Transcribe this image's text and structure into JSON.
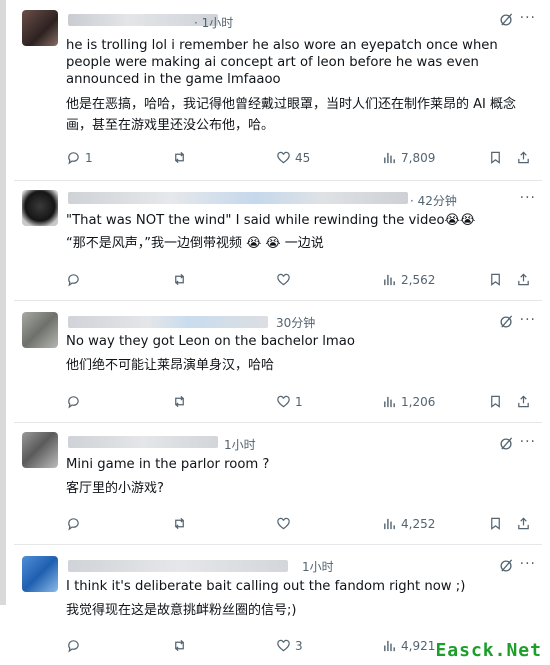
{
  "watermark": "Easck.Net",
  "colors": {
    "text": "#0f1419",
    "muted": "#536471",
    "watermark": "#1b9f2a"
  },
  "actions": {
    "reply_icon": "reply-icon",
    "repost_icon": "repost-icon",
    "like_icon": "heart-icon",
    "views_icon": "views-icon",
    "bookmark_icon": "bookmark-icon",
    "share_icon": "share-icon"
  },
  "posts": [
    {
      "time": "· 1小时",
      "text_en": "he is trolling lol i remember he also wore an eyepatch once when people were making ai concept art of leon before he was even announced in the game lmfaaoo",
      "text_zh": "他是在恶搞，哈哈，我记得他曾经戴过眼罩，当时人们还在制作莱昂的 AI 概念画，甚至在游戏里还没公布他，哈。",
      "replies": "1",
      "reposts": "",
      "likes": "45",
      "views": "7,809"
    },
    {
      "time": "· 42分钟",
      "text_en": "\"That was NOT the wind\" I said while rewinding the video😭😭",
      "text_zh": "“那不是风声，”我一边倒带视频 😭 😭 一边说",
      "replies": "",
      "reposts": "",
      "likes": "",
      "views": "2,562"
    },
    {
      "time": "30分钟",
      "text_en": "No way they got Leon on the bachelor lmao",
      "text_zh": "他们绝不可能让莱昂演单身汉，哈哈",
      "replies": "",
      "reposts": "",
      "likes": "1",
      "views": "1,206"
    },
    {
      "time": "1小时",
      "text_en": "Mini game in the parlor room ?",
      "text_zh": "客厅里的小游戏?",
      "replies": "",
      "reposts": "",
      "likes": "",
      "views": "4,252"
    },
    {
      "time": "1小时",
      "text_en": "I think it's deliberate bait calling out the fandom right now ;)",
      "text_zh": "我觉得现在这是故意挑衅粉丝圈的信号;)",
      "replies": "",
      "reposts": "",
      "likes": "3",
      "views": "4,921"
    }
  ]
}
